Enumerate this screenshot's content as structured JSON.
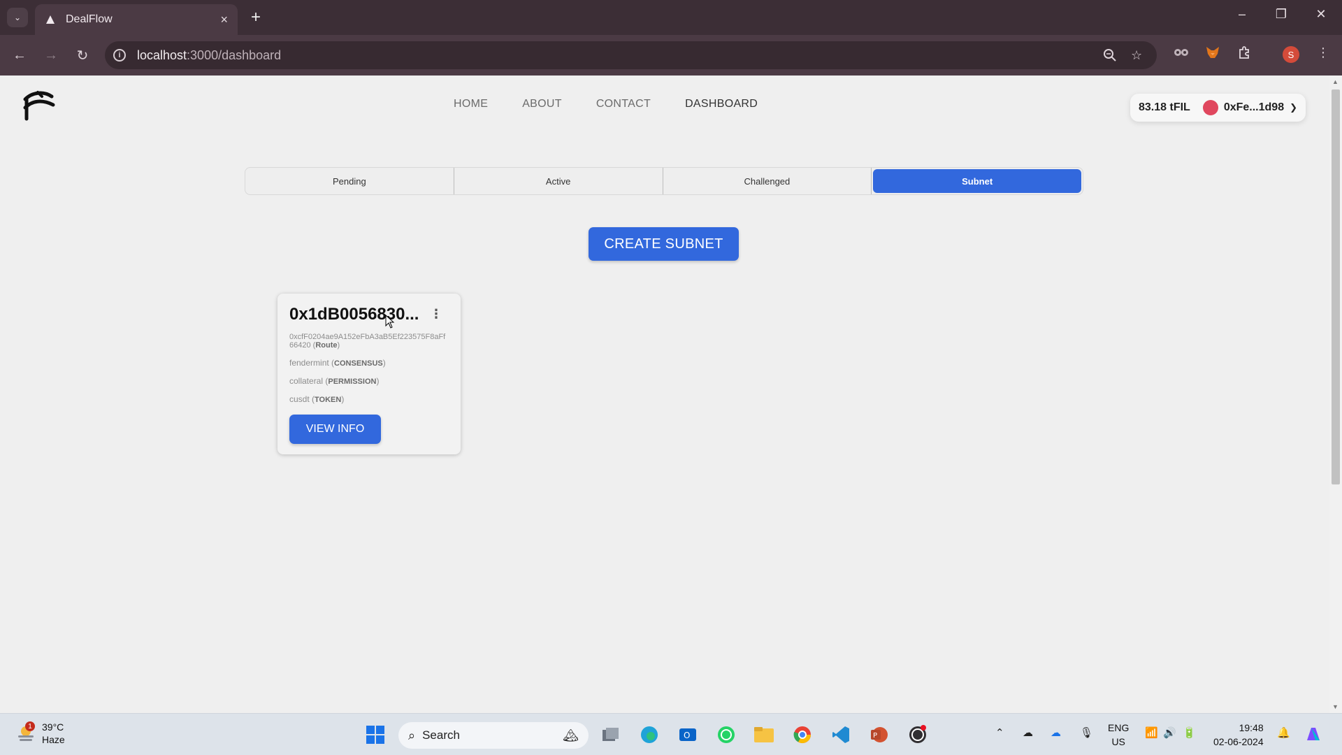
{
  "browser": {
    "tab_title": "DealFlow",
    "url_host": "localhost",
    "url_path": ":3000/dashboard"
  },
  "nav": {
    "items": [
      "HOME",
      "ABOUT",
      "CONTACT",
      "DASHBOARD"
    ]
  },
  "wallet": {
    "balance": "83.18 tFIL",
    "account": "0xFe...1d98"
  },
  "tabs": {
    "items": [
      "Pending",
      "Active",
      "Challenged",
      "Subnet"
    ],
    "selected": "Subnet"
  },
  "create_button": "CREATE SUBNET",
  "subnet_card": {
    "title": "0x1dB0056830...",
    "route_value": "0xcfF0204ae9A152eFbA3aB5Ef223575F8aFf66420",
    "route_label": "Route",
    "consensus_value": "fendermint",
    "consensus_label": "CONSENSUS",
    "permission_value": "collateral",
    "permission_label": "PERMISSION",
    "token_value": "cusdt",
    "token_label": "TOKEN",
    "view_button": "VIEW INFO"
  },
  "taskbar": {
    "weather_temp": "39°C",
    "weather_desc": "Haze",
    "weather_badge": "1",
    "search_label": "Search",
    "lang_top": "ENG",
    "lang_bottom": "US",
    "time": "19:48",
    "date": "02-06-2024"
  },
  "colors": {
    "accent": "#3268dd",
    "chrome": "#4b3a44"
  }
}
